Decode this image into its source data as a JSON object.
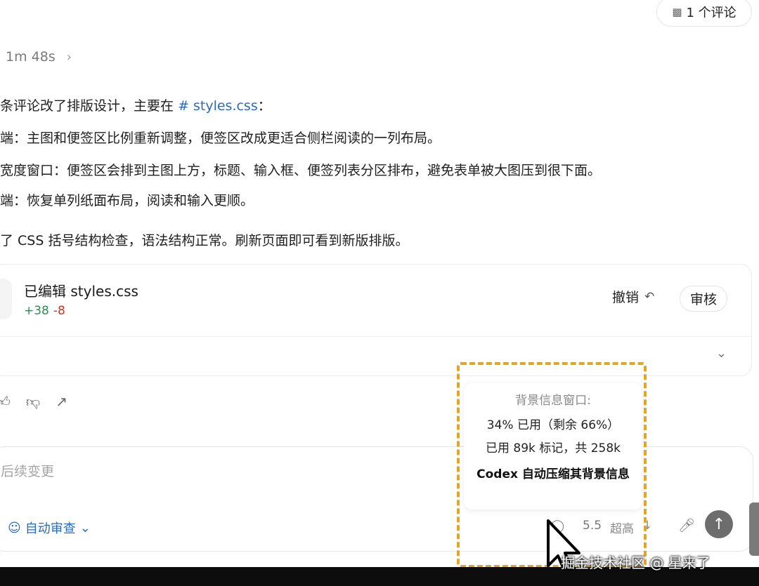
{
  "header": {
    "comment_count_label": "1 个评论"
  },
  "thread": {
    "duration": "1m 48s"
  },
  "message": {
    "intro_prefix": "条评论改了排版设计，主要在",
    "file_link_hash": "#",
    "file_link_name": "styles.css",
    "intro_suffix": "：",
    "lines": [
      "端：主图和便签区比例重新调整，便签区改成更适合侧栏阅读的一列布局。",
      "宽度窗口：便签区会排到主图上方，标题、输入框、便签列表分区排布，避免表单被大图压到很下面。",
      "端：恢复单列纸面布局，阅读和输入更顺。"
    ],
    "summary": "了 CSS 括号结构检查，语法结构正常。刷新页面即可看到新版排版。"
  },
  "edit_card": {
    "title": "已编辑 styles.css",
    "additions": "+38",
    "deletions": "-8",
    "undo_label": "撤销",
    "review_label": "审核"
  },
  "composer": {
    "placeholder": "后续变更",
    "auto_review_label": "自动审查",
    "model_version": "5.5",
    "reasoning_level": "超高"
  },
  "context_popup": {
    "title": "背景信息窗口:",
    "usage_line": "34% 已用（剩余 66%）",
    "tokens_line": "已用 89k 标记，共 258k",
    "compress_note": "Codex 自动压缩其背景信息"
  },
  "watermark": "掘金技术社区 @ 星来了",
  "colors": {
    "accent": "#2b6cb8",
    "highlight": "#e3a623",
    "add": "#2e8b57",
    "del": "#c0392b"
  }
}
